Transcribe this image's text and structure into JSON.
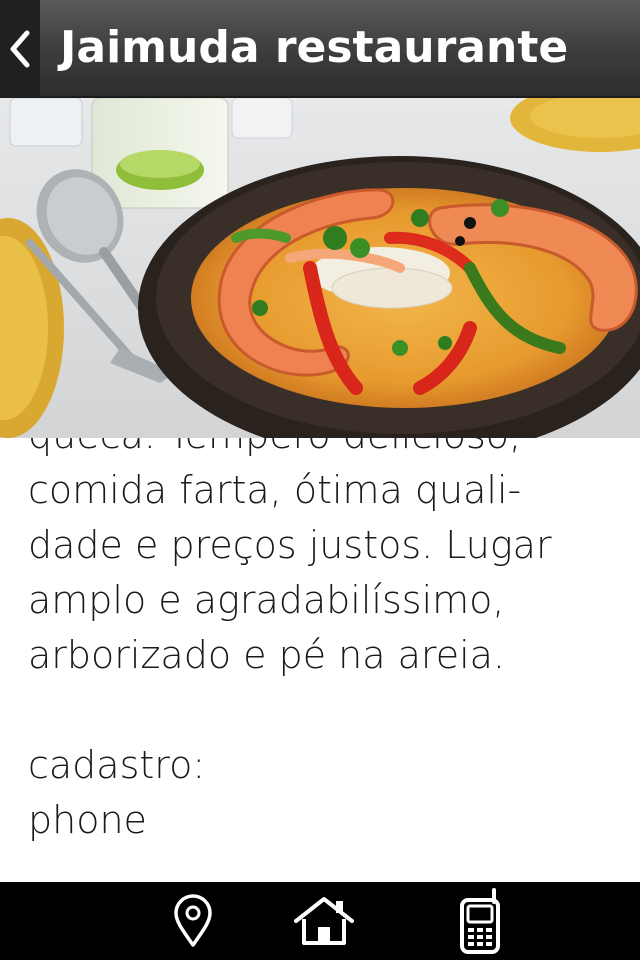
{
  "header": {
    "title": "Jaimuda restaurante",
    "back_icon": "chevron-left-icon"
  },
  "review": {
    "partial_line": "queca. Tempero delicioso,",
    "lines": [
      "comida farta, ótima quali-",
      "dade e preços justos. Lugar",
      "amplo e agradabilíssimo,",
      "arborizado e pé na areia."
    ]
  },
  "info": {
    "cadastro_label": "cadastro:",
    "phone_label": "phone"
  },
  "bottom_nav": {
    "icons": [
      "map-pin-icon",
      "home-icon",
      "phone-icon"
    ]
  },
  "colors": {
    "header": "#3c3c3c",
    "bottom_bar": "#000000",
    "text": "#1a1a1a"
  }
}
